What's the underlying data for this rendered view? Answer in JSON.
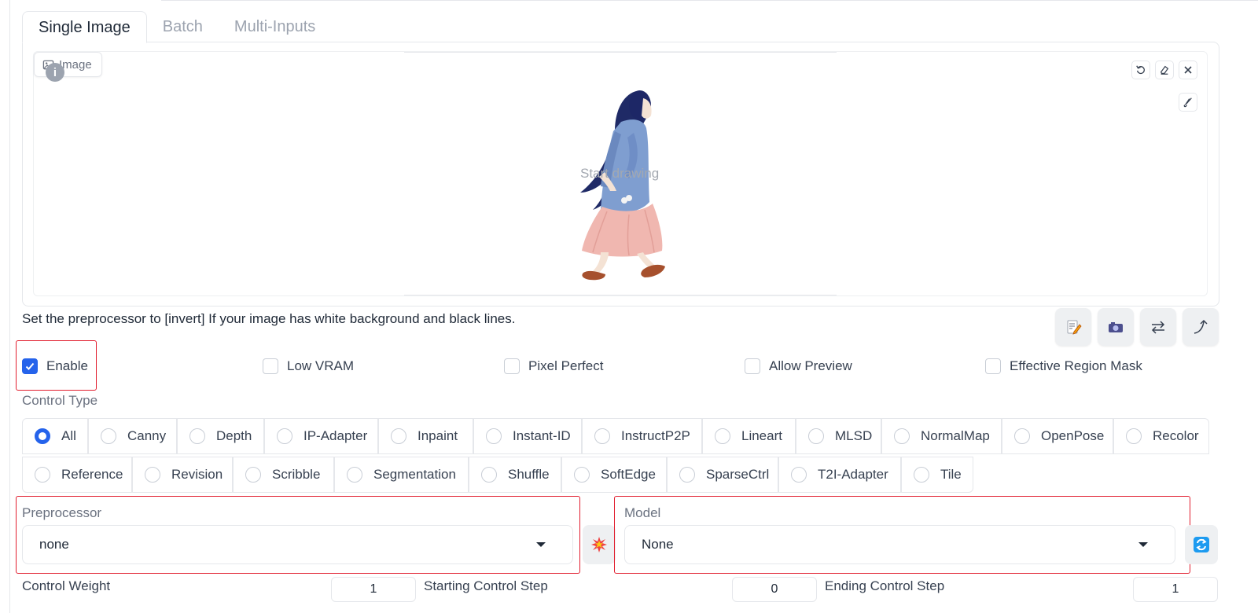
{
  "tabs": [
    {
      "label": "Single Image",
      "active": true
    },
    {
      "label": "Batch",
      "active": false
    },
    {
      "label": "Multi-Inputs",
      "active": false
    }
  ],
  "image_input": {
    "label": "Image",
    "canvas_placeholder": "Start drawing",
    "tools": [
      "undo-icon",
      "eraser-icon",
      "close-icon",
      "brush-icon"
    ]
  },
  "hint": "Set the preprocessor to [invert] If your image has white background and black lines.",
  "action_buttons": [
    "edit-icon",
    "camera-icon",
    "swap-icon",
    "curve-arrow-icon"
  ],
  "checkboxes": [
    {
      "label": "Enable",
      "checked": true
    },
    {
      "label": "Low VRAM",
      "checked": false
    },
    {
      "label": "Pixel Perfect",
      "checked": false
    },
    {
      "label": "Allow Preview",
      "checked": false
    },
    {
      "label": "Effective Region Mask",
      "checked": false
    }
  ],
  "control_type": {
    "label": "Control Type",
    "selected": "All",
    "options": [
      "All",
      "Canny",
      "Depth",
      "IP-Adapter",
      "Inpaint",
      "Instant-ID",
      "InstructP2P",
      "Lineart",
      "MLSD",
      "NormalMap",
      "OpenPose",
      "Recolor",
      "Reference",
      "Revision",
      "Scribble",
      "Segmentation",
      "Shuffle",
      "SoftEdge",
      "SparseCtrl",
      "T2I-Adapter",
      "Tile"
    ]
  },
  "preprocessor": {
    "label": "Preprocessor",
    "value": "none",
    "run_icon": "explosion-icon"
  },
  "model": {
    "label": "Model",
    "value": "None",
    "refresh_icon": "refresh-icon"
  },
  "sliders": {
    "control_weight": {
      "label": "Control Weight",
      "value": "1"
    },
    "starting_step": {
      "label": "Starting Control Step",
      "value": "0"
    },
    "ending_step": {
      "label": "Ending Control Step",
      "value": "1"
    }
  },
  "colors": {
    "accent": "#2563eb",
    "highlight": "#e11d2e",
    "border": "#e5e7eb"
  }
}
